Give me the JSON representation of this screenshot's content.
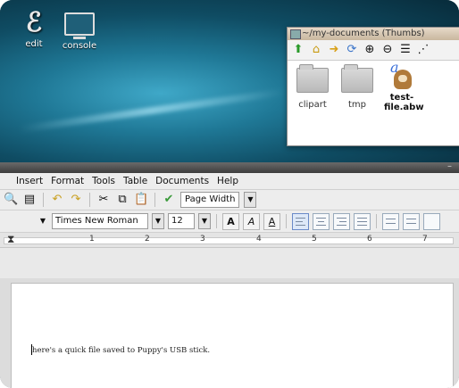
{
  "desktop": {
    "icons": [
      {
        "label": "edit",
        "icon": "pen-icon"
      },
      {
        "label": "console",
        "icon": "monitor-icon"
      }
    ]
  },
  "file_window": {
    "title": "~/my-documents (Thumbs)",
    "toolbar": [
      "up-arrow-icon",
      "home-icon",
      "back-icon",
      "refresh-icon",
      "zoom-in-icon",
      "zoom-out-icon",
      "list-view-icon",
      "more-icon"
    ],
    "items": [
      {
        "name": "clipart",
        "type": "folder"
      },
      {
        "name": "tmp",
        "type": "folder"
      },
      {
        "name": "test-file.abw",
        "type": "document"
      }
    ]
  },
  "abiword": {
    "menu": [
      "Insert",
      "Format",
      "Tools",
      "Table",
      "Documents",
      "Help"
    ],
    "toolbar": {
      "zoom": "Page Width"
    },
    "format": {
      "font": "Times New Roman",
      "size": "12"
    },
    "ruler": [
      "1",
      "2",
      "3",
      "4",
      "5",
      "6",
      "7"
    ],
    "document_text": "here's a quick file saved to Puppy's USB stick."
  }
}
